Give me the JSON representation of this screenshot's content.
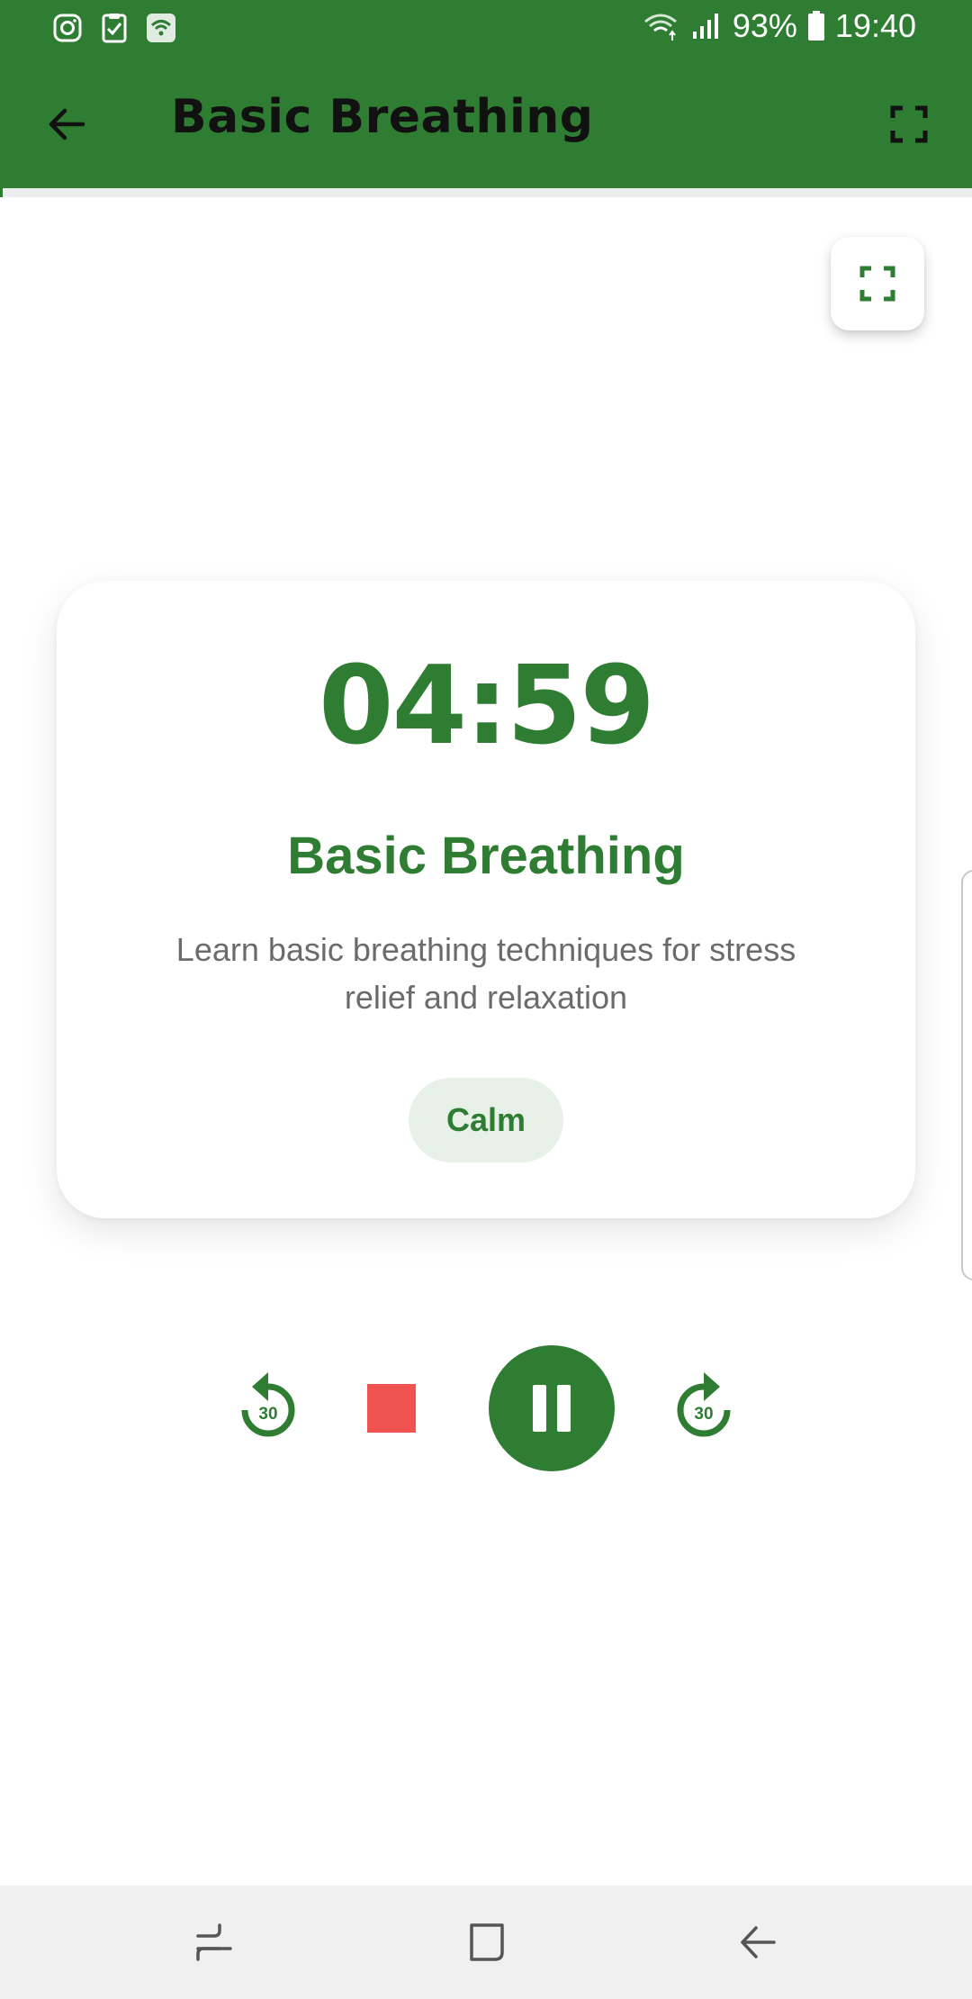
{
  "status_bar": {
    "battery": "93%",
    "time": "19:40",
    "left_icons": [
      "instagram-icon",
      "checklist-icon",
      "wifi-app-icon"
    ],
    "right_icons": [
      "wifi-signal-icon",
      "cell-signal-icon",
      "battery-icon"
    ]
  },
  "app_bar": {
    "title": "Basic Breathing",
    "back_icon": "arrow-left-icon",
    "action_icon": "fullscreen-icon",
    "progress": 0.003
  },
  "fab": {
    "icon": "fullscreen-icon"
  },
  "session": {
    "timer": "04:59",
    "title": "Basic Breathing",
    "description": "Learn basic breathing techniques for stress relief and relaxation",
    "tag": "Calm"
  },
  "controls": {
    "rewind_label": "30",
    "forward_label": "30",
    "stop_icon": "stop-icon",
    "pause_icon": "pause-icon"
  },
  "colors": {
    "primary": "#2e7d32",
    "stop": "#ef5350",
    "chip_bg": "#e8f1e8",
    "text_secondary": "#6b6b6b"
  },
  "nav_bar": {
    "icons": [
      "recents-icon",
      "home-icon",
      "back-icon"
    ]
  }
}
